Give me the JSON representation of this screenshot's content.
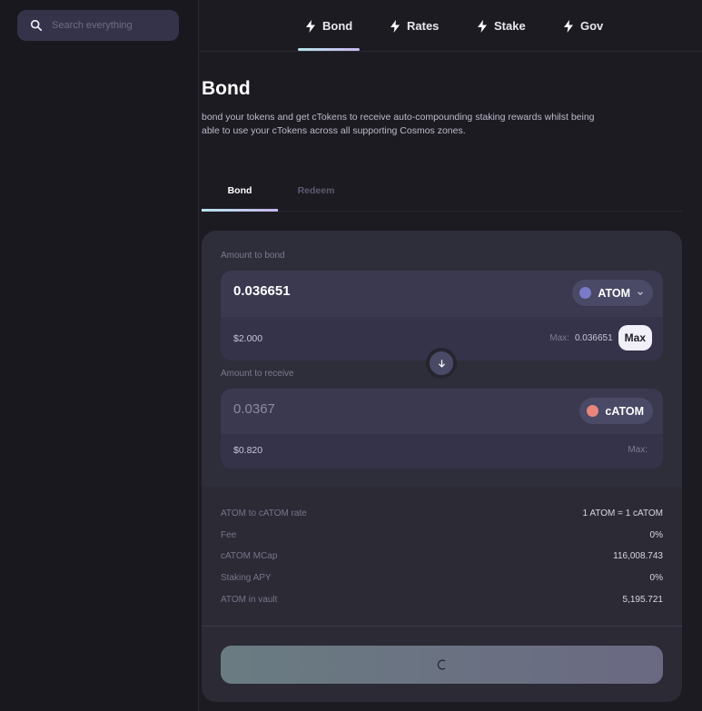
{
  "search": {
    "placeholder": "Search everything"
  },
  "nav": {
    "items": [
      {
        "label": "Bond",
        "active": true
      },
      {
        "label": "Rates",
        "active": false
      },
      {
        "label": "Stake",
        "active": false
      },
      {
        "label": "Gov",
        "active": false
      }
    ]
  },
  "page": {
    "title": "Bond",
    "description": "bond your tokens and get cTokens to receive auto-compounding staking rewards whilst being able to use your cTokens across all supporting Cosmos zones."
  },
  "tabs": [
    {
      "label": "Bond",
      "active": true
    },
    {
      "label": "Redeem",
      "active": false
    }
  ],
  "bond_form": {
    "bond_label": "Amount to bond",
    "bond_amount": "0.036651",
    "bond_token": "ATOM",
    "bond_usd": "$2.000",
    "bond_max_label": "Max:",
    "bond_max_value": "0.036651",
    "max_button": "Max",
    "receive_label": "Amount to receive",
    "receive_amount": "0.0367",
    "receive_token": "cATOM",
    "receive_usd": "$0.820",
    "receive_max_label": "Max:"
  },
  "stats": [
    {
      "key": "ATOM to cATOM rate",
      "value": "1 ATOM = 1 cATOM"
    },
    {
      "key": "Fee",
      "value": "0%"
    },
    {
      "key": "cATOM MCap",
      "value": "116,008.743"
    },
    {
      "key": "Staking APY",
      "value": "0%"
    },
    {
      "key": "ATOM in vault",
      "value": "5,195.721"
    }
  ],
  "colors": {
    "accent_gradient_start": "#b8e3ea",
    "accent_gradient_end": "#c6b6ef",
    "atom_token": "#7b79c9",
    "catom_token": "#e8867d"
  },
  "icons": {
    "search": "search-icon",
    "nav": "lightning-icon",
    "token_menu": "chevron-down-icon",
    "swap": "arrow-down-icon",
    "submit": "loading-spinner-icon"
  }
}
